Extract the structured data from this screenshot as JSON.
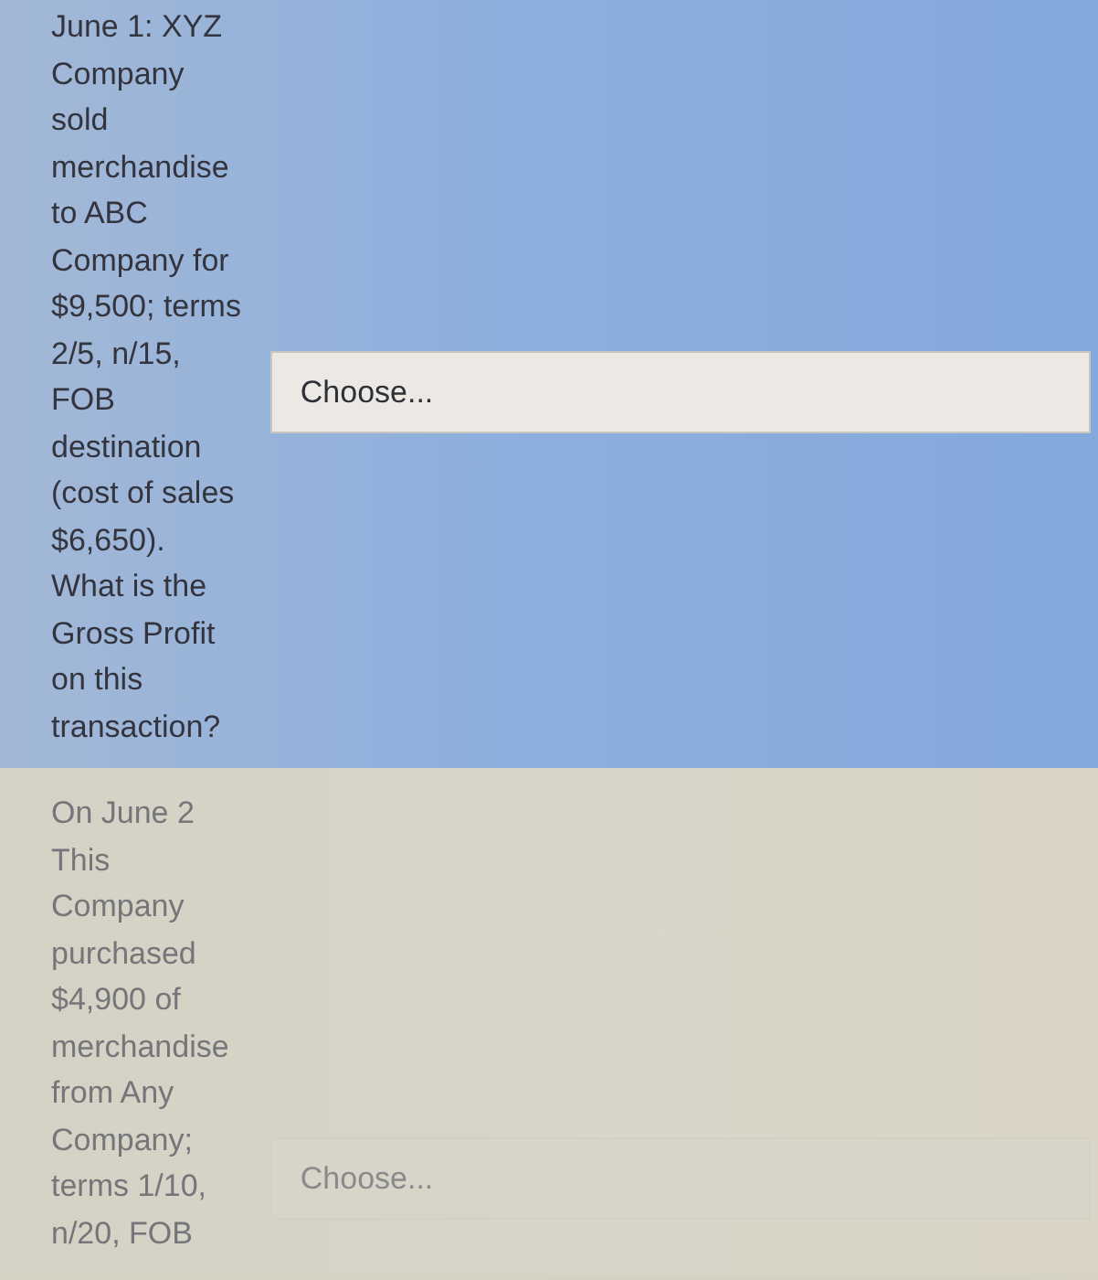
{
  "questions": [
    {
      "text": "June 1: XYZ Company sold merchandise to ABC Company for $9,500; terms 2/5, n/15, FOB destination (cost of sales $6,650). What is the Gross Profit on this transaction?",
      "highlighted": true,
      "answer": {
        "value": "Choose..."
      }
    },
    {
      "text": "On June 2 This Company purchased $4,900 of merchandise from Any Company; terms 1/10, n/20, FOB",
      "highlighted": false,
      "answer": {
        "value": "Choose..."
      }
    }
  ]
}
